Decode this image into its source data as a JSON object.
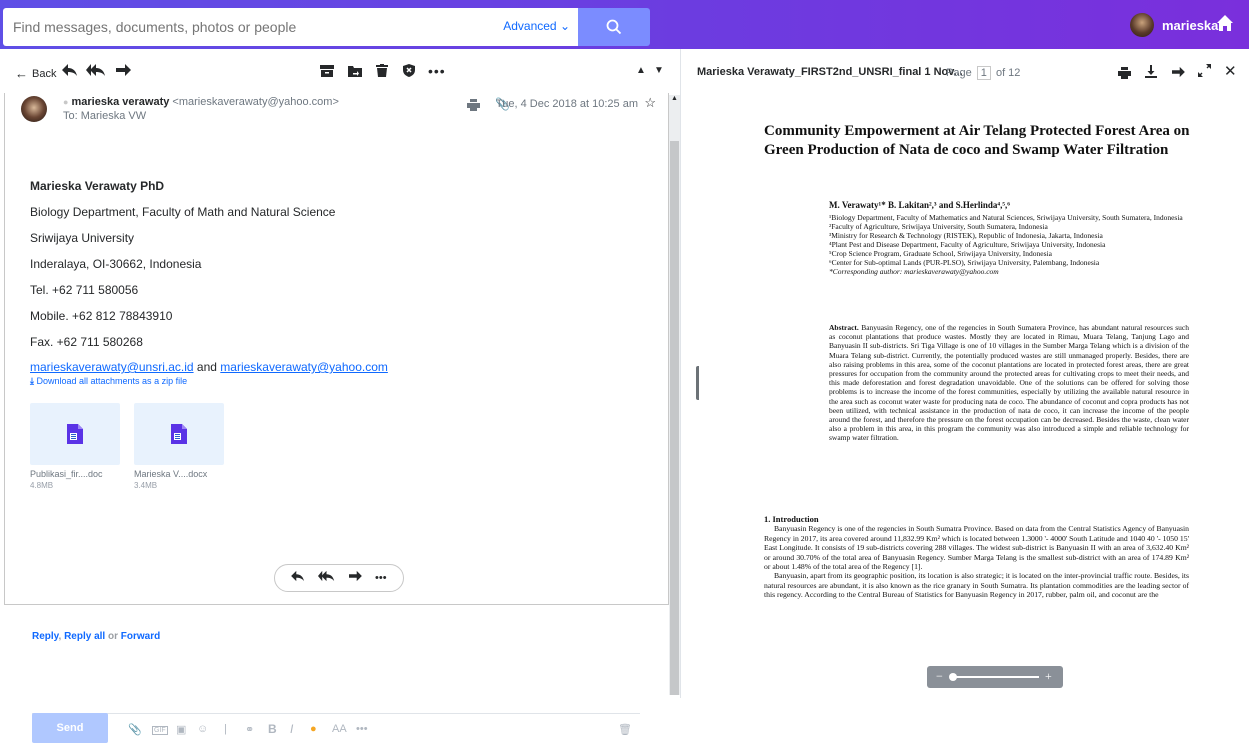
{
  "search": {
    "placeholder": "Find messages, documents, photos or people",
    "advanced": "Advanced"
  },
  "user": {
    "name": "marieska"
  },
  "message_toolbar": {
    "back": "Back"
  },
  "email": {
    "from_name": "marieska verawaty",
    "from_email": "<marieskaverawaty@yahoo.com>",
    "to": "To: Marieska VW",
    "date": "Tue, 4 Dec 2018 at 10:25 am",
    "signature": {
      "name": "Marieska Verawaty PhD",
      "line1": "Biology Department, Faculty of Math and Natural Science",
      "line2": "Sriwijaya University",
      "line3": "Inderalaya, OI-30662, Indonesia",
      "tel": "Tel. +62 711 580056",
      "mobile": "Mobile. +62 812 78843910",
      "fax": "Fax. +62 711 580268",
      "email1": "marieskaverawaty@unsri.ac.id",
      "and": "and",
      "email2": "marieskaverawaty@yahoo.com"
    },
    "download_all": "Download all attachments as a zip file",
    "attachments": [
      {
        "name": "Publikasi_fir....doc",
        "size": "4.8MB"
      },
      {
        "name": "Marieska V....docx",
        "size": "3.4MB"
      }
    ]
  },
  "reply": {
    "reply": "Reply",
    "reply_all": "Reply all",
    "or": "or",
    "forward": "Forward"
  },
  "compose": {
    "send": "Send"
  },
  "doc_viewer": {
    "title": "Marieska Verawaty_FIRST2nd_UNSRI_final 1 Nov...",
    "page_label": "Page",
    "page_current": "1",
    "page_total": "of 12"
  },
  "paper": {
    "title": "Community Empowerment at Air Telang Protected Forest Area on Green Production of Nata de coco and Swamp Water Filtration",
    "authors": "M. Verawaty¹* B. Lakitan²,³ and S.Herlinda⁴,⁵,⁶",
    "affiliations": [
      "¹Biology Department, Faculty of Mathematics and Natural Sciences, Sriwijaya University, South Sumatera, Indonesia",
      "²Faculty of Agriculture, Sriwijaya University, South Sumatera, Indonesia",
      "³Ministry for Research & Technology (RISTEK), Republic of Indonesia, Jakarta, Indonesia",
      "⁴Plant Pest and Disease Department, Faculty of Agriculture, Sriwijaya University, Indonesia",
      "⁵Crop Science Program, Graduate School, Sriwijaya University, Indonesia",
      "⁶Center for Sub-optimal Lands (PUR-PLSO), Sriwijaya University, Palembang, Indonesia",
      "*Corresponding author: marieskaverawaty@yahoo.com"
    ],
    "abstract_label": "Abstract.",
    "abstract": "Banyuasin Regency, one of the regencies in South Sumatera Province, has abundant natural resources such as coconut plantations that produce wastes. Mostly they are located in Rimau, Muara Telang, Tanjung Lago and Banyuasin II sub-districts. Sri Tiga Village is one of 10 villages in the Sumber Marga Telang which is a division of the Muara Telang sub-district. Currently, the potentially produced wastes are still unmanaged properly. Besides, there are also raising problems in this area, some of the coconut plantations are located in protected forest areas, there are great pressures for occupation from the community around the protected areas for cultivating crops to meet their needs, and this made deforestation and forest degradation unavoidable. One of the solutions can be offered for solving those problems is to increase the income of the forest communities, especially by utilizing the available natural resource in the area such as coconut water waste for producing nata de coco. The abundance of coconut and copra products has not been utilized, with technical assistance in the production of nata de coco, it can increase the income of the people around the forest, and therefore the pressure on the forest occupation can be decreased. Besides the waste, clean water also a problem in this area, in this program the community was also introduced a simple and reliable technology for swamp water filtration.",
    "intro_heading": "1. Introduction",
    "intro_p1": "Banyuasin Regency is one of the regencies in South Sumatra Province. Based on data from the Central Statistics Agency of Banyuasin Regency in 2017, its area covered around 11,832.99 Km² which is located between 1.3000 '- 4000' South Latitude and 1040 40 '- 1050 15' East Longitude. It consists of 19 sub-districts covering 288 villages. The widest sub-district is Banyuasin II with an area of 3,632.40 Km² or around 30.70% of the total area of Banyuasin Regency. Sumber Marga Telang is the smallest sub-district with an area of 174.89 Km² or about 1.48% of the total area of the Regency [1].",
    "intro_p2": "Banyuasin, apart from its geographic position, its location is also strategic; it is located on the inter-provincial traffic route. Besides, its natural resources are abundant, it is also known as the rice granary in South Sumatra. Its plantation commodities are the leading sector of this regency. According to the Central Bureau of Statistics for Banyuasin Regency in 2017, rubber, palm oil, and coconut are the"
  },
  "zoom": {
    "minus": "−",
    "plus": "+"
  },
  "colors": {
    "accent": "#0f69ff",
    "topbar": "#6c3ce0",
    "send": "#b0c8ff"
  }
}
